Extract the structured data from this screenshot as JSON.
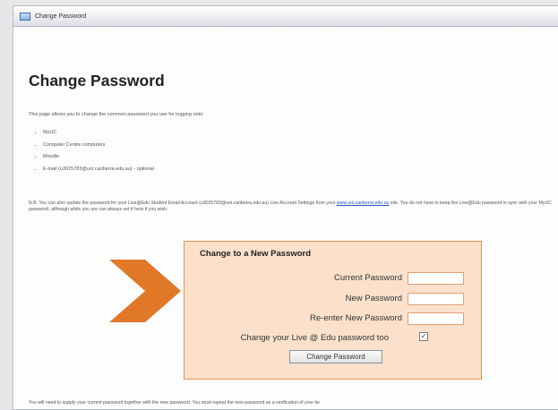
{
  "window": {
    "title": "Change Password"
  },
  "page": {
    "heading": "Change Password",
    "intro": "This page allows you to change the common password you use for logging onto:",
    "list": [
      "MyUC",
      "Computer Centre computers",
      "Moodle",
      "E-mail (u3025783@uni.canberra.edu.au) - optional"
    ],
    "note_part1": "N.B. You can also update the password for your Live@Edu Student Email Account (u3025783@uni.canberra.edu.au) Live Account Settings from",
    "note_your": "your",
    "note_link": "www.uni.canberra.edu.au",
    "note_part2": "site. You do not have to keep the Live@Edu password in sync with your MyUC password, although while you are",
    "note_part3": "can always set it here if you wish.",
    "footer": "You will need to supply your current password together with the new password. You must repeat the new password as a verification of your ke"
  },
  "form": {
    "title": "Change to a New Password",
    "current_label": "Current Password",
    "new_label": "New Password",
    "reenter_label": "Re-enter New Password",
    "live_label": "Change your Live @ Edu password too",
    "live_checked": true,
    "submit_label": "Change Password"
  },
  "colors": {
    "accent_arrow": "#e07828",
    "panel_bg": "#fbe1cc",
    "panel_border": "#e58f4e"
  },
  "icons": {
    "window": "window-icon",
    "arrow": "arrow-chevron-icon",
    "check": "checkmark-icon"
  }
}
